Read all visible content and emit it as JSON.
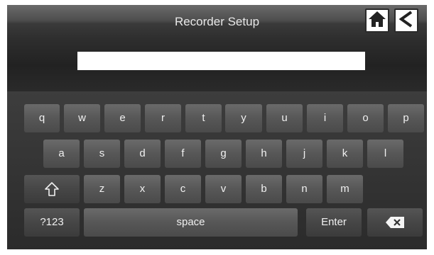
{
  "header": {
    "title": "Recorder Setup",
    "home_icon": "home-icon",
    "back_icon": "back-arrow-icon"
  },
  "text_input": {
    "value": ""
  },
  "keyboard": {
    "row1": [
      "q",
      "w",
      "e",
      "r",
      "t",
      "y",
      "u",
      "i",
      "o",
      "p"
    ],
    "row2": [
      "a",
      "s",
      "d",
      "f",
      "g",
      "h",
      "j",
      "k",
      "l"
    ],
    "row3": [
      "z",
      "x",
      "c",
      "v",
      "b",
      "n",
      "m"
    ],
    "shift_icon": "shift-arrow-icon",
    "mode_label": "?123",
    "space_label": "space",
    "enter_label": "Enter",
    "backspace_icon": "backspace-icon"
  },
  "colors": {
    "panel": "#2a2a2a",
    "key": "#575757",
    "text": "#f0f0f0"
  }
}
